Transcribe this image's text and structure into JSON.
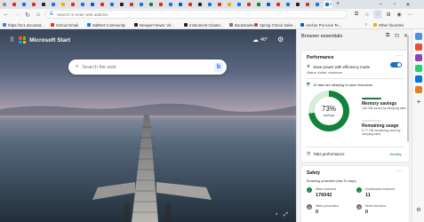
{
  "toolbar": {
    "address_placeholder": "Search or enter web address"
  },
  "favorites": [
    {
      "label": "https://sc1.securant...",
      "color": "#3a7bd5"
    },
    {
      "label": "School Email",
      "color": "#d93025"
    },
    {
      "label": "SaltNet Community",
      "color": "#1a73e8"
    },
    {
      "label": "Newport News: Vir...",
      "color": "#222222"
    },
    {
      "label": "Instrument Cluster...",
      "color": "#222222"
    },
    {
      "label": "Bookmarks",
      "color": "#777777"
    },
    {
      "label": "Spring Check Valve...",
      "color": "#d93025"
    },
    {
      "label": "Anchor Pro-Line Te...",
      "color": "#0b57d0"
    },
    {
      "label": "Other favorites",
      "color": "#e8b400"
    }
  ],
  "newtab": {
    "brand": "Microsoft Start",
    "weather": "40°",
    "search_placeholder": "Search the web"
  },
  "pane": {
    "title": "Browser essentials",
    "performance": {
      "title": "Performance",
      "efficiency_label": "Save power with efficiency mode",
      "status_text": "Status: Active, maximum",
      "sleeping_text": "14 tabs are sleeping to save resources",
      "savings_percent": "73%",
      "savings_label": "savings",
      "memory_title": "Memory savings",
      "memory_desc": "155 GB saved by sleeping tabs",
      "remaining_title": "Remaining usage",
      "remaining_desc": "0.77 GB remaining used by sleeping tabs",
      "tabs_performance": "Tabs performance",
      "health": "Healthy"
    },
    "safety": {
      "title": "Safety",
      "subtitle": "Browsing protection (last 30 days)",
      "sites_scanned_label": "Sites scanned",
      "sites_scanned": "176042",
      "downloads_label": "Downloads scanned",
      "downloads": "11",
      "sites_prevented_label": "Sites prevented",
      "sites_prevented": "0",
      "items_blocked_label": "Items blocked",
      "items_blocked": "0"
    }
  },
  "colors": {
    "accent": "#1a6fc7",
    "healthy": "#13823a",
    "memory_bar": "#13823a",
    "remaining_bar": "#d8ecd9"
  }
}
